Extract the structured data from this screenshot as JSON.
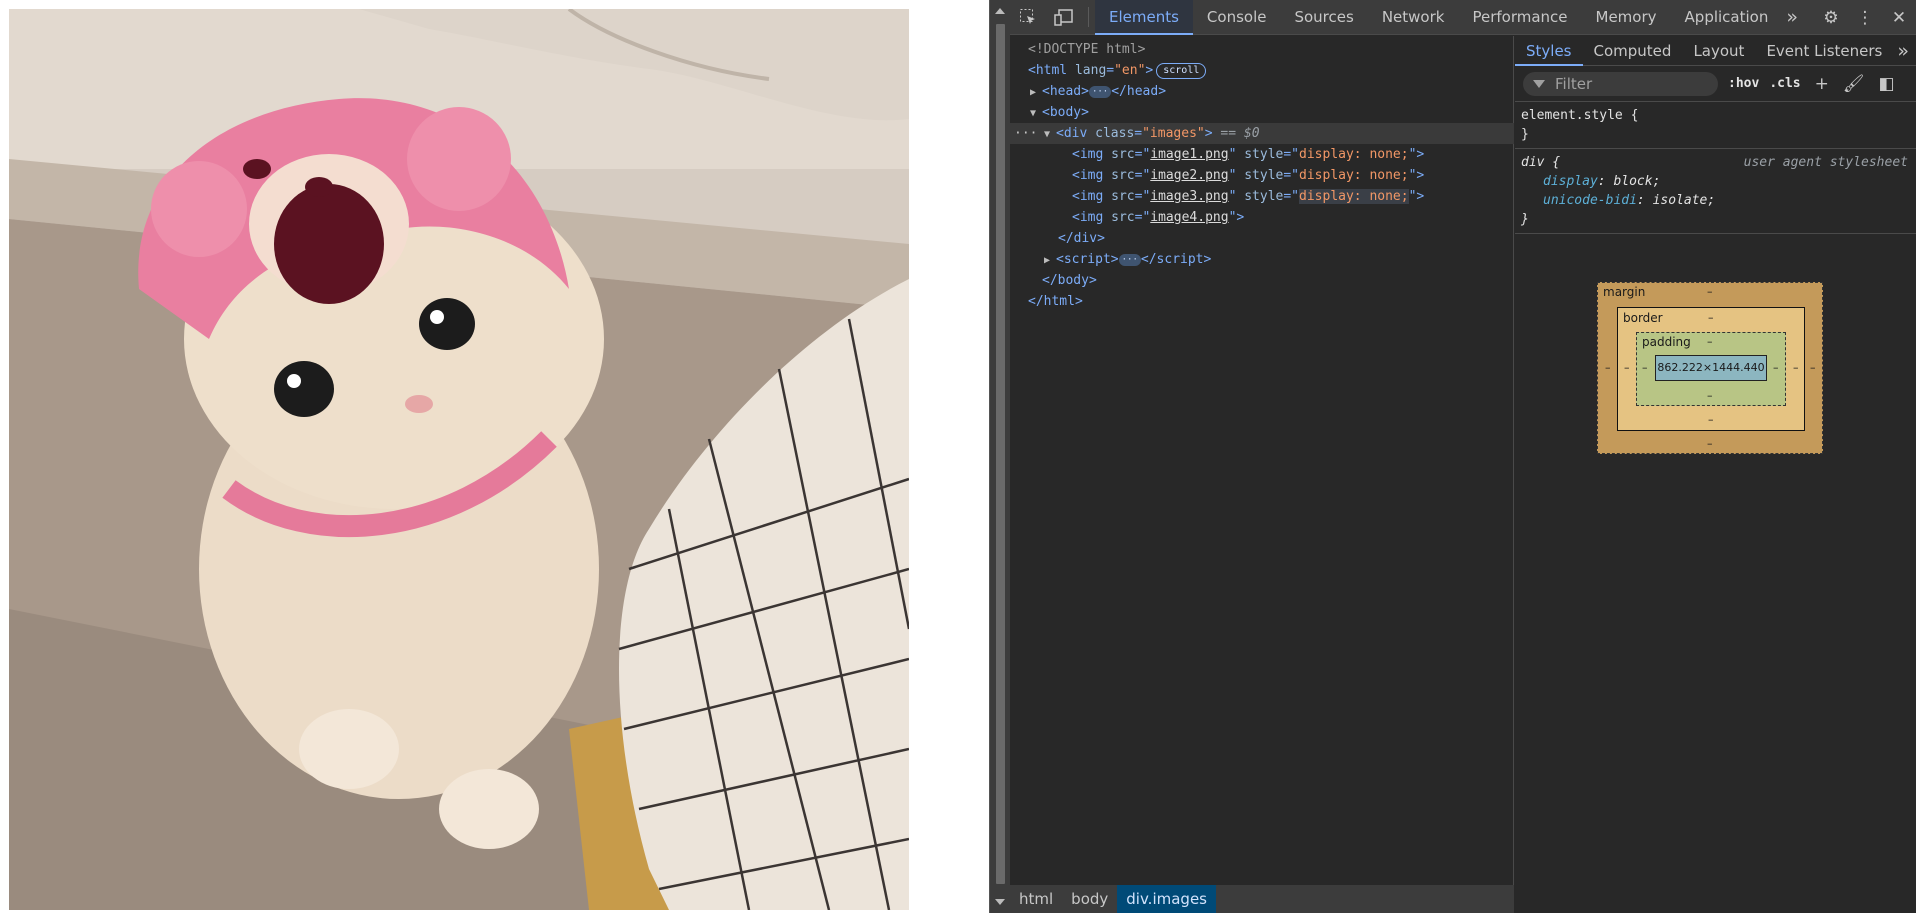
{
  "page": {
    "image_alt": "Cream cat wearing a pink bear hat"
  },
  "devtools": {
    "tabs": [
      "Elements",
      "Console",
      "Sources",
      "Network",
      "Performance",
      "Memory",
      "Application"
    ],
    "more_tabs": "»",
    "elements": {
      "doctype": "<!DOCTYPE html>",
      "html_open_tag": "html",
      "html_lang_attr": "lang",
      "html_lang_value": "\"en\"",
      "scroll_badge": "scroll",
      "head_tag": "head",
      "body_tag": "body",
      "div_tag": "div",
      "div_class_attr": "class",
      "div_class_value": "\"images\"",
      "selected_marker": "== $0",
      "images": [
        {
          "src": "image1.png",
          "style": "display: none;"
        },
        {
          "src": "image2.png",
          "style": "display: none;"
        },
        {
          "src": "image3.png",
          "style": "display: none;"
        },
        {
          "src": "image4.png",
          "style": ""
        }
      ],
      "script_tag": "script"
    },
    "breadcrumbs": [
      "html",
      "body",
      "div.images"
    ],
    "styles": {
      "tabs": [
        "Styles",
        "Computed",
        "Layout",
        "Event Listeners"
      ],
      "more": "»",
      "filter_placeholder": "Filter",
      "hov_label": ":hov",
      "cls_label": ".cls",
      "element_style_selector": "element.style {",
      "element_style_close": "}",
      "rule_selector": "div {",
      "rule_origin": "user agent stylesheet",
      "declarations": [
        {
          "prop": "display",
          "value": "block;"
        },
        {
          "prop": "unicode-bidi",
          "value": "isolate;"
        }
      ],
      "rule_close": "}",
      "box_model": {
        "margin_label": "margin",
        "border_label": "border",
        "padding_label": "padding",
        "content_size": "862.222×1444.440",
        "dash": "–"
      }
    }
  },
  "colors": {
    "devtools_bg": "#282828",
    "accent": "#7cacf8",
    "tag": "#7cacf8",
    "attr_value": "#f29766"
  }
}
